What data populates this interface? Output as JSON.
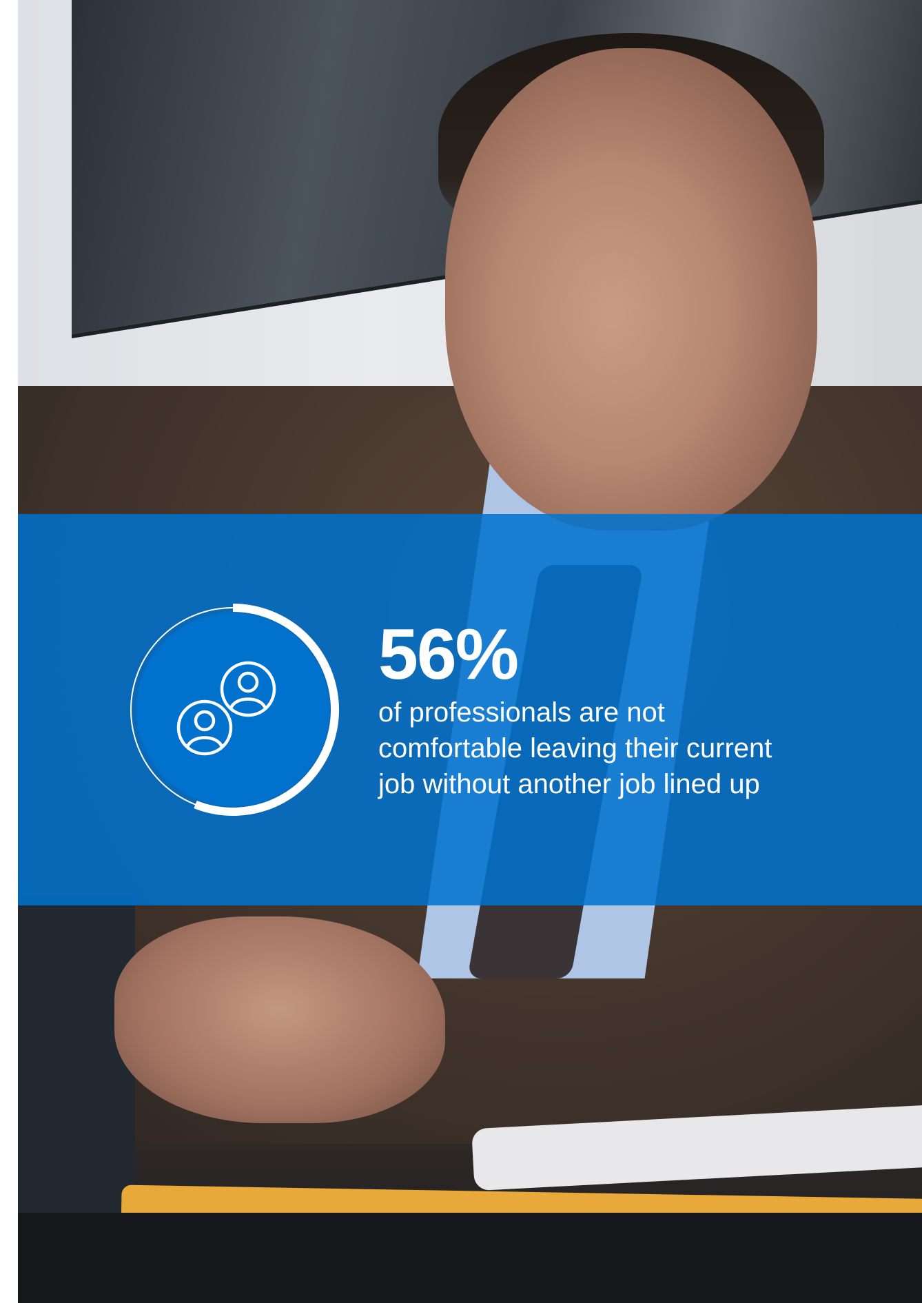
{
  "stat": {
    "value": "56%",
    "percent": 56,
    "description": "of professionals are not comfortable leaving their current job without another job lined up"
  },
  "icon": "people-network-icon",
  "colors": {
    "band": "#0072ce",
    "text": "#ffffff"
  }
}
